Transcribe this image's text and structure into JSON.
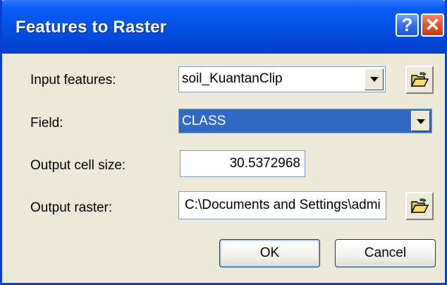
{
  "window": {
    "title": "Features to Raster",
    "help_glyph": "?",
    "close_glyph": "✕"
  },
  "form": {
    "input_features": {
      "label": "Input features:",
      "value": "soil_KuantanClip"
    },
    "field": {
      "label": "Field:",
      "value": "CLASS"
    },
    "cell_size": {
      "label": "Output cell size:",
      "value": "30.5372968"
    },
    "output_raster": {
      "label": "Output raster:",
      "value": "C:\\Documents and Settings\\admi"
    }
  },
  "buttons": {
    "ok_label": "OK",
    "cancel_label": "Cancel"
  },
  "icons": {
    "browse": "open-folder-icon",
    "dropdown": "chevron-down-icon",
    "help": "help-icon",
    "close": "close-icon"
  },
  "colors": {
    "title_bar": "#0454e6",
    "dialog_bg": "#ece9d8",
    "selection": "#316ac5",
    "close_button": "#e0532d"
  }
}
